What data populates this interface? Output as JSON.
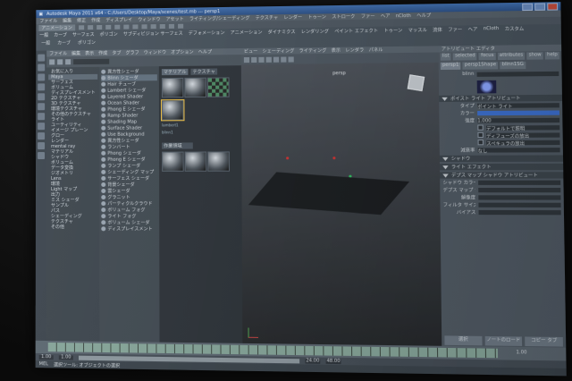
{
  "window": {
    "title": "Autodesk Maya 2011 x64 - C:/Users/Desktop/Maya/scenes/test.mb --- persp1",
    "app": "Maya"
  },
  "menubar": [
    "ファイル",
    "編集",
    "修正",
    "作成",
    "ディスプレイ",
    "ウィンドウ",
    "アセット",
    "ライティング/シェーディング",
    "テクスチャ",
    "レンダー",
    "トゥーン",
    "ストローク",
    "ファー",
    "ヘア",
    "nCloth",
    "ヘルプ"
  ],
  "statusline": {
    "mode": "アニメーション"
  },
  "shelf": {
    "tabs": [
      "一般",
      "カーブ",
      "サーフェス",
      "ポリゴン",
      "サブディビジョン サーフェス",
      "デフォメーション",
      "アニメーション",
      "ダイナミクス",
      "レンダリング",
      "ペイント エフェクト",
      "トゥーン",
      "マッスル",
      "流体",
      "ファー",
      "ヘア",
      "nCloth",
      "カスタム"
    ],
    "items": [
      "一般",
      "カーブ",
      "ポリゴン"
    ]
  },
  "hypershade": {
    "menu": [
      "ファイル",
      "編集",
      "表示",
      "作成",
      "タブ",
      "グラフ",
      "ウィンドウ",
      "オプション",
      "ヘルプ"
    ],
    "tree": [
      "お気に入り",
      "Maya",
      "サーフェス",
      "ボリューム",
      "ディスプレイスメント",
      "2D テクスチャ",
      "3D テクスチャ",
      "環境テクスチャ",
      "その他のテクスチャ",
      "ライト",
      "ユーティリティ",
      "イメージ プレーン",
      "グロー",
      "レンダー",
      "mental ray",
      "マテリアル",
      "シャドウ",
      "ボリューム",
      "データ変換",
      "ジオメトリ",
      "Lens",
      "環境",
      "Light マップ",
      "出力",
      "ミス シェーダ",
      "サンプル",
      "パス",
      "シェーディング",
      "テクスチャ",
      "その他"
    ],
    "nodes": [
      "異方性シェーダ",
      "Blinn シェーダ",
      "Hair チューブ",
      "Lambert シェーダ",
      "Layered Shader",
      "Ocean Shader",
      "Phong E シェーダ",
      "Ramp Shader",
      "Shading Map",
      "Surface Shader",
      "Use Background",
      "異方性シェーダ",
      "ランバート",
      "Phong シェーダ",
      "Phong E シェーダ",
      "ランプ シェーダ",
      "シェーディング マップ",
      "サーフェス シェーダ",
      "背景シェーダ",
      "雲シェーダ",
      "グラニット",
      "パーティクルクラウド",
      "ボリューム フォグ",
      "ライト フォグ",
      "ボリューム シェーダ",
      "ディスプレイスメント"
    ],
    "swatchTabs": [
      "マテリアル",
      "テクスチャ"
    ],
    "swatchLabels": [
      "lambert1",
      "blinn1",
      "particleCloud1",
      "shaderGlow1"
    ],
    "workTab": "作業領域"
  },
  "viewport": {
    "menu": [
      "ビュー",
      "シェーディング",
      "ライティング",
      "表示",
      "レンダラ",
      "パネル"
    ],
    "cameraLabel": "persp"
  },
  "attributeEditor": {
    "title": "アトリビュート エディタ",
    "tabs": [
      "list",
      "selected",
      "focus",
      "attributes",
      "show",
      "help"
    ],
    "nodeTabs": [
      "persp1",
      "persp1Shape",
      "blinn1SG"
    ],
    "nodeType": "blinn",
    "sections": [
      "ボイスト ライト アトリビュート",
      "シャドウ",
      "ライト エフェクト",
      "デプス マップ シャドウ アトリビュート"
    ],
    "rows": [
      {
        "label": "タイプ",
        "value": "ポイント ライト"
      },
      {
        "label": "カラー",
        "value": ""
      },
      {
        "label": "強度",
        "value": "1.000"
      },
      {
        "label": "",
        "value": "デフォルトで照明"
      },
      {
        "label": "",
        "value": "ディフューズの放出"
      },
      {
        "label": "",
        "value": "スペキュラの放出"
      },
      {
        "label": "減衰率",
        "value": "なし"
      }
    ],
    "shadowRows": [
      "シャドウ カラー",
      "デプス マップ シャドウの使用",
      "解像度",
      "フィルタ サイズ",
      "バイアス"
    ],
    "bottomButtons": [
      "選択",
      "ノートのロード",
      "コピー タブ"
    ]
  },
  "timeline": {
    "start": "1.00",
    "end": "24.00",
    "rangeStart": "1.00",
    "rangeEnd": "48.00",
    "current": "1.00"
  },
  "cmdline": {
    "prefix": "MEL",
    "help": "選択ツール: オブジェクトの選択"
  }
}
